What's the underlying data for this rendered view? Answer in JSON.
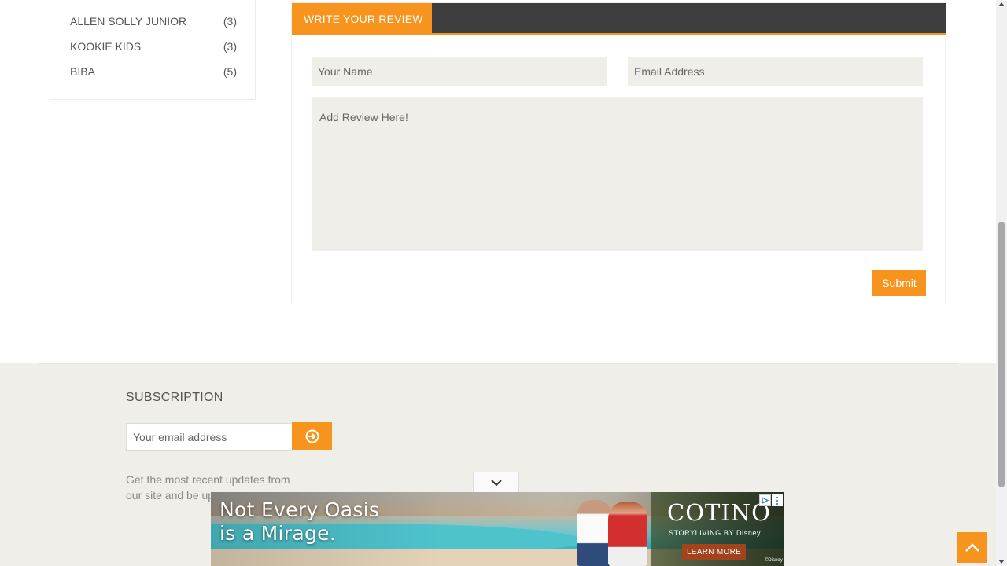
{
  "sidebar": {
    "brands": [
      {
        "name": "ALLEN SOLLY JUNIOR",
        "count": "(3)"
      },
      {
        "name": "KOOKIE KIDS",
        "count": "(3)"
      },
      {
        "name": "BIBA",
        "count": "(5)"
      }
    ]
  },
  "review": {
    "tab_label": "WRITE YOUR REVIEW",
    "name_placeholder": "Your Name",
    "email_placeholder": "Email Address",
    "review_placeholder": "Add Review Here!",
    "submit_label": "Submit"
  },
  "footer": {
    "subscription_title": "SUBSCRIPTION",
    "email_placeholder": "Your email address",
    "description": "Get the most recent updates from our site and be up..."
  },
  "ad": {
    "headline_line1": "Not Every Oasis",
    "headline_line2": "is a Mirage.",
    "brand": "COTINO",
    "brand_sub": "STORYLIVING BY Disney",
    "cta": "LEARN MORE",
    "copyright": "©Disney"
  },
  "colors": {
    "accent": "#f7941d",
    "header_dark": "#3e3e3e",
    "field_bg": "#efeee8",
    "footer_bg": "#efeee8"
  }
}
